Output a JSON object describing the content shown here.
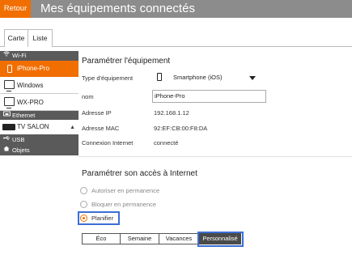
{
  "header": {
    "back_label": "Retour",
    "title": "Mes équipements connectés",
    "bar_color": "#8c8c8c",
    "accent_color": "#f16e00"
  },
  "tabs": [
    {
      "label": "Carte"
    },
    {
      "label": "Liste"
    }
  ],
  "sidebar": {
    "wifi": {
      "label": "Wi-Fi",
      "icon": "wifi-icon"
    },
    "devices": [
      {
        "label": "iPhone-Pro",
        "icon": "smartphone-icon",
        "active": true
      },
      {
        "label": "Windows",
        "icon": "laptop-icon",
        "active": false
      },
      {
        "label": "WX-PRO",
        "icon": "laptop-icon",
        "active": false
      }
    ],
    "ethernet": {
      "label": "Ethernet",
      "icon": "ethernet-icon"
    },
    "ethernet_devices": [
      {
        "label": "TV SALON",
        "icon": "tv-icon",
        "expanded": true
      }
    ],
    "usb": {
      "label": "USB",
      "icon": "usb-icon"
    },
    "objets": {
      "label": "Objets",
      "icon": "home-icon"
    }
  },
  "device_settings": {
    "title": "Paramétrer l'équipement",
    "type_label": "Type d'équipement",
    "type_value": "Smartphone (iOS)",
    "name_label": "nom",
    "name_value": "iPhone-Pro",
    "ip_label": "Adresse IP",
    "ip_value": "192.168.1.12",
    "mac_label": "Adresse MAC",
    "mac_value": "92:EF:CB:00:F8:DA",
    "conn_label": "Connexion Internet",
    "conn_value": "connecté"
  },
  "access": {
    "title": "Paramétrer son accès à Internet",
    "options": [
      {
        "label": "Autoriser en permanence",
        "checked": false
      },
      {
        "label": "Bloquer en permanence",
        "checked": false
      },
      {
        "label": "Planifier",
        "checked": true
      }
    ],
    "schedule_modes": [
      {
        "label": "Éco",
        "selected": false
      },
      {
        "label": "Semaine",
        "selected": false
      },
      {
        "label": "Vacances",
        "selected": false
      },
      {
        "label": "Personnalisé",
        "selected": true
      }
    ],
    "highlight_color": "#3b6fd4"
  }
}
